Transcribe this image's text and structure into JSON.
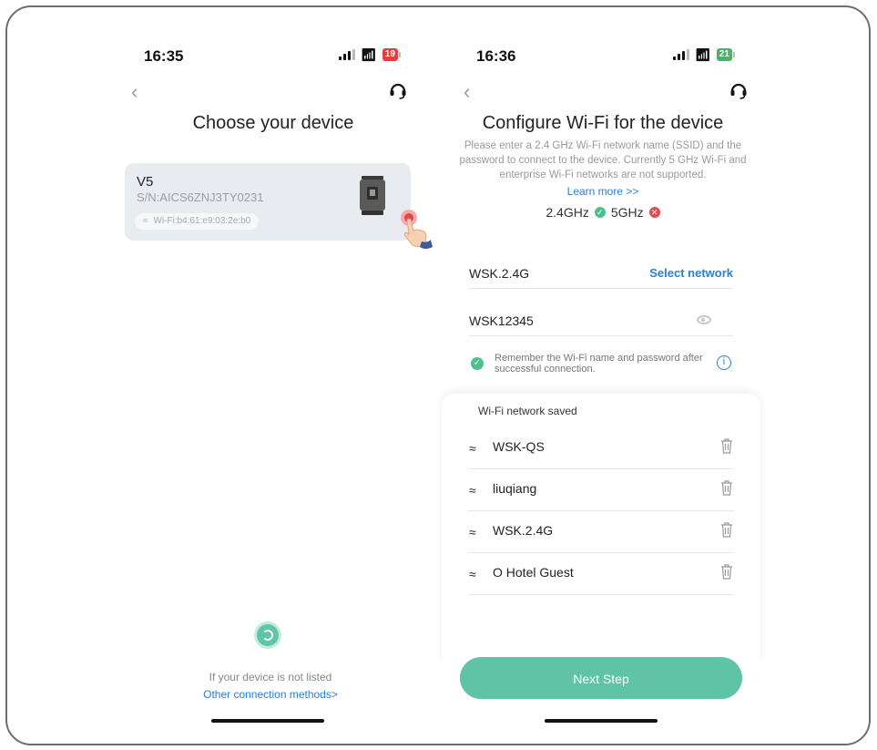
{
  "left": {
    "time": "16:35",
    "battery": "19",
    "title": "Choose your device",
    "device": {
      "name": "V5",
      "sn": "S/N:AICS6ZNJ3TY0231",
      "wifi": "Wi-Fi:b4:61:e9:03:2e:b0"
    },
    "not_listed": "If your device is not listed",
    "other_methods": "Other connection methods>"
  },
  "right": {
    "time": "16:36",
    "battery": "21",
    "title": "Configure Wi-Fi for the device",
    "description": "Please enter a 2.4 GHz Wi-Fi network name (SSID) and the password to connect to the device. Currently 5 GHz Wi-Fi and enterprise Wi-Fi networks are not supported.",
    "learn_more": "Learn more >>",
    "band_24": "2.4GHz",
    "band_5": "5GHz",
    "ssid": "WSK.2.4G",
    "select_network": "Select network",
    "password": "WSK12345",
    "remember_text": "Remember the Wi-Fi name and password after successful connection.",
    "saved_title": "Wi-Fi network saved",
    "saved_networks": [
      "WSK-QS",
      "liuqiang",
      "WSK.2.4G",
      "O Hotel Guest"
    ],
    "next_step": "Next Step"
  },
  "colors": {
    "accent": "#5fc4a6",
    "link": "#2a7fd6",
    "ok": "#4fc08d",
    "error": "#e24b4b"
  }
}
